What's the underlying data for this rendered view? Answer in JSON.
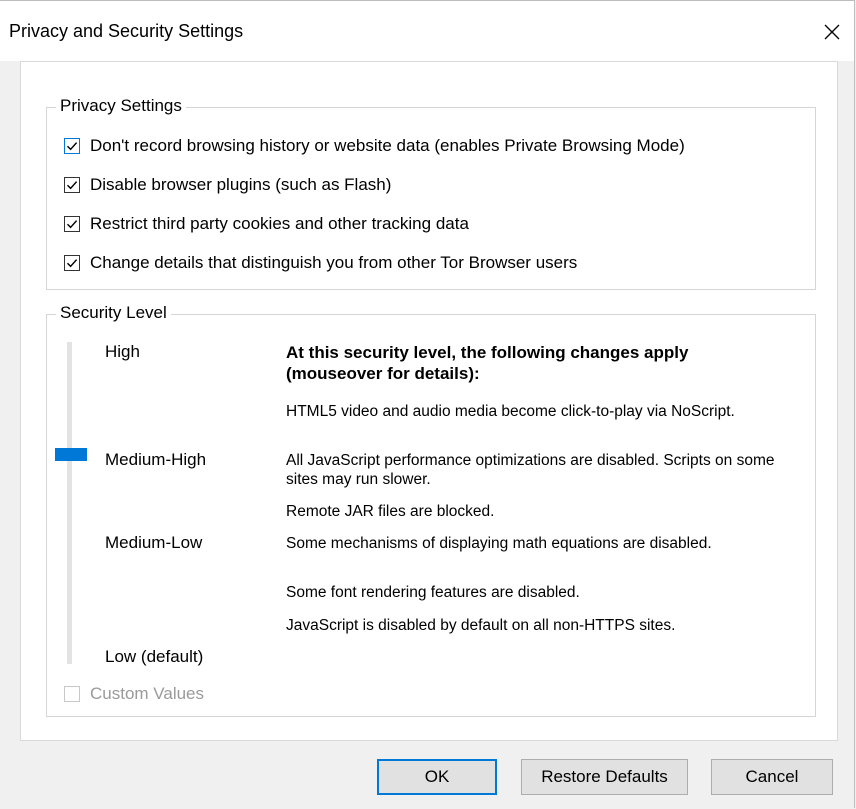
{
  "window": {
    "title": "Privacy and Security Settings",
    "close_icon": "close-icon"
  },
  "privacy": {
    "legend": "Privacy Settings",
    "options": [
      {
        "label": "Don't record browsing history or website data (enables Private Browsing Mode)",
        "checked": true,
        "focused": true
      },
      {
        "label": "Disable browser plugins (such as Flash)",
        "checked": true
      },
      {
        "label": "Restrict third party cookies and other tracking data",
        "checked": true
      },
      {
        "label": "Change details that distinguish you from other Tor Browser users",
        "checked": true
      }
    ]
  },
  "security": {
    "legend": "Security Level",
    "levels": [
      "High",
      "Medium-High",
      "Medium-Low",
      "Low (default)"
    ],
    "selected_level": "Medium-High",
    "info_title": "At this security level, the following changes apply (mouseover for details):",
    "changes": [
      "HTML5 video and audio media become click-to-play via NoScript.",
      "All JavaScript performance optimizations are disabled. Scripts on some sites may run slower.",
      "Remote JAR files are blocked.",
      "Some mechanisms of displaying math equations are disabled.",
      "Some font rendering features are disabled.",
      "JavaScript is disabled by default on all non-HTTPS sites."
    ],
    "custom_values": {
      "label": "Custom Values",
      "checked": false,
      "disabled": true
    }
  },
  "buttons": {
    "ok": "OK",
    "restore": "Restore Defaults",
    "cancel": "Cancel"
  },
  "colors": {
    "accent": "#0078d7",
    "panel_bg": "#ffffff",
    "window_bg": "#f0f0f0"
  }
}
